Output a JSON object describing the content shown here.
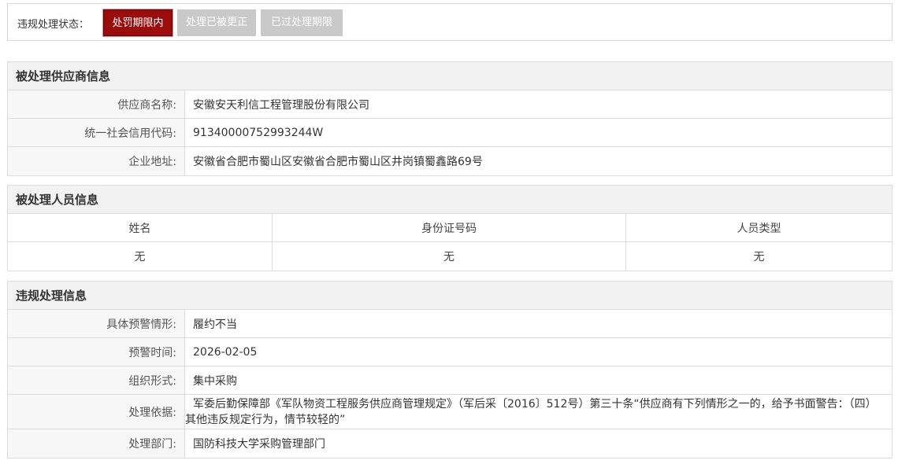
{
  "status": {
    "label": "违规处理状态：",
    "buttons": [
      {
        "label": "处罚期限内",
        "active": true
      },
      {
        "label": "处理已被更正",
        "active": false
      },
      {
        "label": "已过处理期限",
        "active": false
      }
    ]
  },
  "supplier": {
    "title": "被处理供应商信息",
    "rows": [
      {
        "label": "供应商名称:",
        "value": "安徽安天利信工程管理股份有限公司"
      },
      {
        "label": "统一社会信用代码:",
        "value": "91340000752993244W"
      },
      {
        "label": "企业地址:",
        "value": "安徽省合肥市蜀山区安徽省合肥市蜀山区井岗镇蜀鑫路69号"
      }
    ]
  },
  "personnel": {
    "title": "被处理人员信息",
    "headers": [
      "姓名",
      "身份证号码",
      "人员类型"
    ],
    "rows": [
      [
        "无",
        "无",
        "无"
      ]
    ]
  },
  "violation": {
    "title": "违规处理信息",
    "rows": [
      {
        "label": "具体预警情形:",
        "value": "履约不当"
      },
      {
        "label": "预警时间:",
        "value": "2026-02-05"
      },
      {
        "label": "组织形式:",
        "value": "集中采购"
      },
      {
        "label": "处理依据:",
        "value": "军委后勤保障部《军队物资工程服务供应商管理规定》（军后采〔2016〕512号）第三十条“供应商有下列情形之一的，给予书面警告：（四）其他违反规定行为，情节较轻的”"
      },
      {
        "label": "处理部门:",
        "value": "国防科技大学采购管理部门"
      }
    ]
  },
  "colors": {
    "active_button": "#9b0c0c",
    "inactive_button": "#c9c9c9",
    "header_bg": "#f2f2f2",
    "border": "#dcdcdc"
  }
}
